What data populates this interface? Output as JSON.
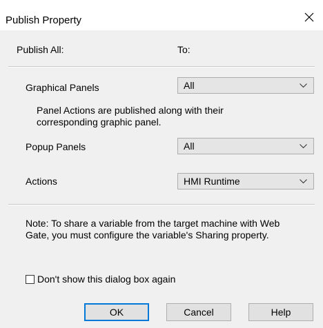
{
  "dialog": {
    "title": "Publish Property",
    "close_icon": "close-icon"
  },
  "header": {
    "left_label": "Publish All:",
    "right_label": "To:"
  },
  "rows": {
    "graphical_panels": {
      "label": "Graphical Panels",
      "selected": "All"
    },
    "info_text": "Panel Actions are published along with their corresponding graphic panel.",
    "popup_panels": {
      "label": "Popup Panels",
      "selected": "All"
    },
    "actions": {
      "label": "Actions",
      "selected": "HMI Runtime"
    }
  },
  "note": "Note: To share a variable from the target machine with Web Gate, you must configure the variable's Sharing property.",
  "checkbox": {
    "label": "Don't show this dialog box again",
    "checked": false
  },
  "buttons": {
    "ok": "OK",
    "cancel": "Cancel",
    "help": "Help"
  },
  "colors": {
    "dialog_bg": "#f0f0f0",
    "titlebar_bg": "#ffffff",
    "default_button_border": "#0078d7"
  },
  "icons": {
    "dropdown": "chevron-down-icon",
    "close": "close-icon"
  }
}
